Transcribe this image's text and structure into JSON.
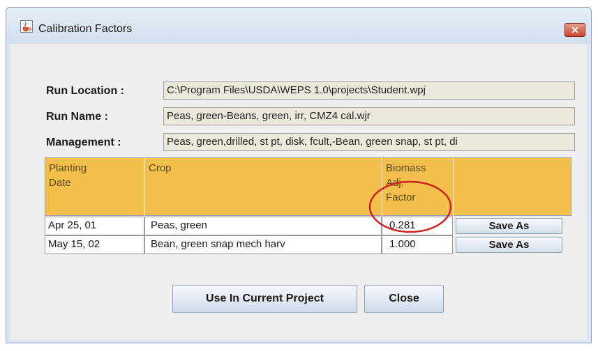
{
  "window": {
    "title": "Calibration Factors",
    "close_glyph": "✕"
  },
  "fields": {
    "run_location": {
      "label": "Run Location :",
      "value": "C:\\Program Files\\USDA\\WEPS 1.0\\projects\\Student.wpj"
    },
    "run_name": {
      "label": "Run Name :",
      "value": "Peas, green-Beans, green, irr, CMZ4 cal.wjr"
    },
    "management": {
      "label": "Management :",
      "value": "Peas, green,drilled, st pt, disk, fcult,-Bean, green snap, st pt, di"
    }
  },
  "table": {
    "headers": {
      "planting_date": "Planting\nDate",
      "crop": "Crop",
      "biomass": "Biomass\nAdj.\nFactor",
      "action": ""
    },
    "rows": [
      {
        "date": "Apr 25, 01",
        "crop": "Peas, green",
        "factor": "0.281",
        "action": "Save As"
      },
      {
        "date": "May 15, 02",
        "crop": "Bean, green snap mech harv",
        "factor": "1.000",
        "action": "Save As"
      }
    ]
  },
  "buttons": {
    "use_current": "Use In Current Project",
    "close": "Close"
  },
  "colors": {
    "header_bg": "#f5bf4b",
    "annotation": "#cc2222"
  },
  "icons": {
    "app": "java-cup-icon",
    "close": "close-icon"
  }
}
